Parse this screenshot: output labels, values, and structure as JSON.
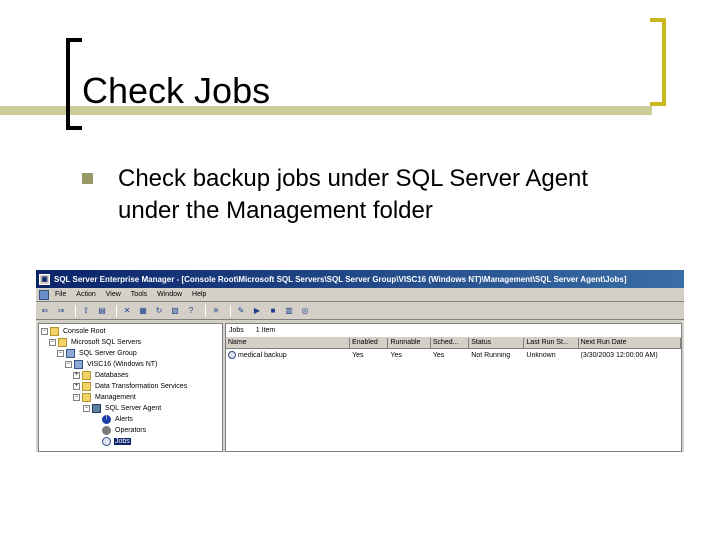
{
  "slide": {
    "title": "Check Jobs",
    "bullets": [
      "Check backup jobs under SQL Server Agent under the Management folder"
    ]
  },
  "window": {
    "title": "SQL Server Enterprise Manager - [Console Root\\Microsoft SQL Servers\\SQL Server Group\\VISC16 (Windows NT)\\Management\\SQL Server Agent\\Jobs]",
    "menu": [
      "File",
      "Action",
      "View",
      "Tools",
      "Window",
      "Help"
    ],
    "toolbar_icons": [
      "back-arrow-icon",
      "forward-arrow-icon",
      "up-folder-icon",
      "show-hide-tree-icon",
      "delete-icon",
      "properties-icon",
      "refresh-icon",
      "export-list-icon",
      "help-icon",
      "wizard-icon",
      "new-job-icon",
      "start-job-icon",
      "stop-job-icon",
      "job-history-icon",
      "registered-server-icon"
    ],
    "tree": [
      {
        "label": "Console Root",
        "level": 0,
        "toggle": "-",
        "icon": "folder-icon"
      },
      {
        "label": "Microsoft SQL Servers",
        "level": 1,
        "toggle": "-",
        "icon": "folder-icon"
      },
      {
        "label": "SQL Server Group",
        "level": 2,
        "toggle": "-",
        "icon": "server-group-icon"
      },
      {
        "label": "VISC16 (Windows NT)",
        "level": 3,
        "toggle": "-",
        "icon": "server-icon"
      },
      {
        "label": "Databases",
        "level": 4,
        "toggle": "+",
        "icon": "folder-icon"
      },
      {
        "label": "Data Transformation Services",
        "level": 4,
        "toggle": "+",
        "icon": "folder-icon"
      },
      {
        "label": "Management",
        "level": 4,
        "toggle": "-",
        "icon": "folder-icon"
      },
      {
        "label": "SQL Server Agent",
        "level": 5,
        "toggle": "-",
        "icon": "agent-icon"
      },
      {
        "label": "Alerts",
        "level": 6,
        "toggle": "",
        "icon": "alert-icon"
      },
      {
        "label": "Operators",
        "level": 6,
        "toggle": "",
        "icon": "operators-icon"
      },
      {
        "label": "Jobs",
        "level": 6,
        "toggle": "",
        "icon": "jobs-icon",
        "selected": true
      }
    ],
    "list": {
      "caption": "Jobs",
      "count": "1 Item",
      "columns": [
        "Name",
        "Enabled",
        "Runnable",
        "Sched...",
        "Status",
        "Last Run St...",
        "Next Run Date"
      ],
      "rows": [
        [
          "medical backup",
          "Yes",
          "Yes",
          "Yes",
          "Not Running",
          "Unknown",
          "(3/30/2003 12:00:00 AM)"
        ]
      ]
    }
  }
}
